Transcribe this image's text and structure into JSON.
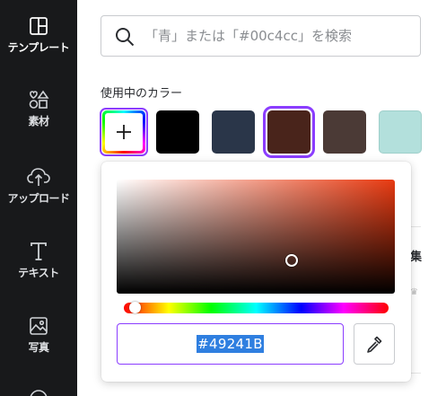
{
  "sidebar": {
    "items": [
      {
        "label": "テンプレート",
        "icon": "template-icon",
        "active": true
      },
      {
        "label": "素材",
        "icon": "elements-icon"
      },
      {
        "label": "アップロード",
        "icon": "upload-cloud-icon"
      },
      {
        "label": "テキスト",
        "icon": "text-icon"
      },
      {
        "label": "写真",
        "icon": "photo-icon"
      }
    ]
  },
  "search": {
    "placeholder": "「青」または「#00c4cc」を検索"
  },
  "colors_section": {
    "title": "使用中のカラー",
    "swatches": [
      "#000000",
      "#2a3649",
      "#49241b",
      "#4b3a36",
      "#b3e0dc"
    ],
    "selected": "#49241b"
  },
  "picker": {
    "hex_value": "#49241B",
    "hue_fraction": 0.04,
    "saturation_fraction": 0.63,
    "brightness_fraction": 0.29
  },
  "background_hint": {
    "text": "集"
  },
  "colors": {
    "accent": "#8b3dff",
    "rail_bg": "#18191b"
  }
}
